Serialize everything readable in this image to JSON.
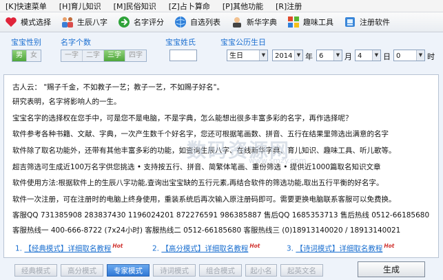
{
  "menu": [
    "[K]快速菜单",
    "[H]育儿知识",
    "[M]民俗知识",
    "[Z]占卜算命",
    "[P]其他功能",
    "[R]注册"
  ],
  "toolbar": [
    {
      "label": "模式选择",
      "icon": "heart-icon"
    },
    {
      "label": "生辰八字",
      "icon": "family-icon"
    },
    {
      "label": "名字评分",
      "icon": "green-arrow-icon"
    },
    {
      "label": "自选列表",
      "icon": "globe-icon"
    },
    {
      "label": "新华字典",
      "icon": "person-icon"
    },
    {
      "label": "趣味工具",
      "icon": "windows-icon"
    },
    {
      "label": "注册软件",
      "icon": "register-icon"
    }
  ],
  "controls": {
    "gender": {
      "label": "宝宝性别",
      "options": [
        "男",
        "女"
      ],
      "selected": "男"
    },
    "name_count": {
      "label": "名字个数",
      "options": [
        "一字",
        "二字",
        "三字",
        "四字"
      ],
      "selected": "三字"
    },
    "surname": {
      "label": "宝宝姓氏",
      "value": ""
    },
    "birthday": {
      "label": "宝宝公历生日",
      "type": "生日",
      "year": "2014",
      "year_unit": "年",
      "month": "6",
      "month_unit": "月",
      "day": "4",
      "day_unit": "日",
      "hour": "0",
      "hour_unit": "时"
    }
  },
  "content": {
    "lines": [
      "古人云：  \"赐子千金，不如教子一艺；教子一艺，不如赐子好名\"。",
      "研究表明，名字将影响人的一生。",
      "宝宝名字的选择权在您手中，可是您不是电脑，不是字典，怎么能想出很多丰富多彩的名字，再作选择呢？",
      "软件参考各种书籍、文献、字典，一次产生数千个好名字，您还可根据笔画数、拼音、五行在结果里筛选出满意的名字",
      "软件除了取名功能外，还带有其他丰富多彩的功能，如查询生辰八字、在线新华字典、育儿知识、趣味工具、听儿歌等。",
      "超吉筛选可生成近100万名字供您挑选  • 支持按五行、拼音、简繁体笔画、重份筛选  • 提供近1000篇取名知识文章",
      "软件使用方法:根据软件上的生辰八字功能,查询出宝宝缺的五行元素,再结合软件的筛选功能,取出五行平衡的好名字。",
      "软件一次注册，可在注册时的电脑上终身使用，重装系统后再次输入原注册码即可。需要更换电脑联系客服可以免费换。",
      "客服QQ  731385908   283837430   1196024201   872276591   986385887   售后QQ  1685353713   售后热线  0512-66185680",
      "客服热线一  400-666-8722  (7x24小时)   客服热线二  0512-66185680      客服热线三  (0)18913140020 / 18913140021"
    ],
    "links": [
      {
        "num": "1.",
        "text": "【经典模式】详细取名教程",
        "hot": "Hot"
      },
      {
        "num": "2.",
        "text": "【高分模式】详细取名教程",
        "hot": "Hot"
      },
      {
        "num": "3.",
        "text": "【诗词模式】详细取名教程",
        "hot": "Hot"
      }
    ],
    "watermark": "数码资源网",
    "watermark_url": "www.smzy.com"
  },
  "modes": [
    "经典模式",
    "高分模式",
    "专家模式",
    "诗词模式",
    "组合模式",
    "起小名",
    "起英文名"
  ],
  "active_mode": "专家模式",
  "generate_label": "生成",
  "colors": {
    "accent": "#1b6fd1",
    "active_tab": "#2f78d6",
    "hot": "#d0312d",
    "green_toggle": "#4fa63b"
  }
}
